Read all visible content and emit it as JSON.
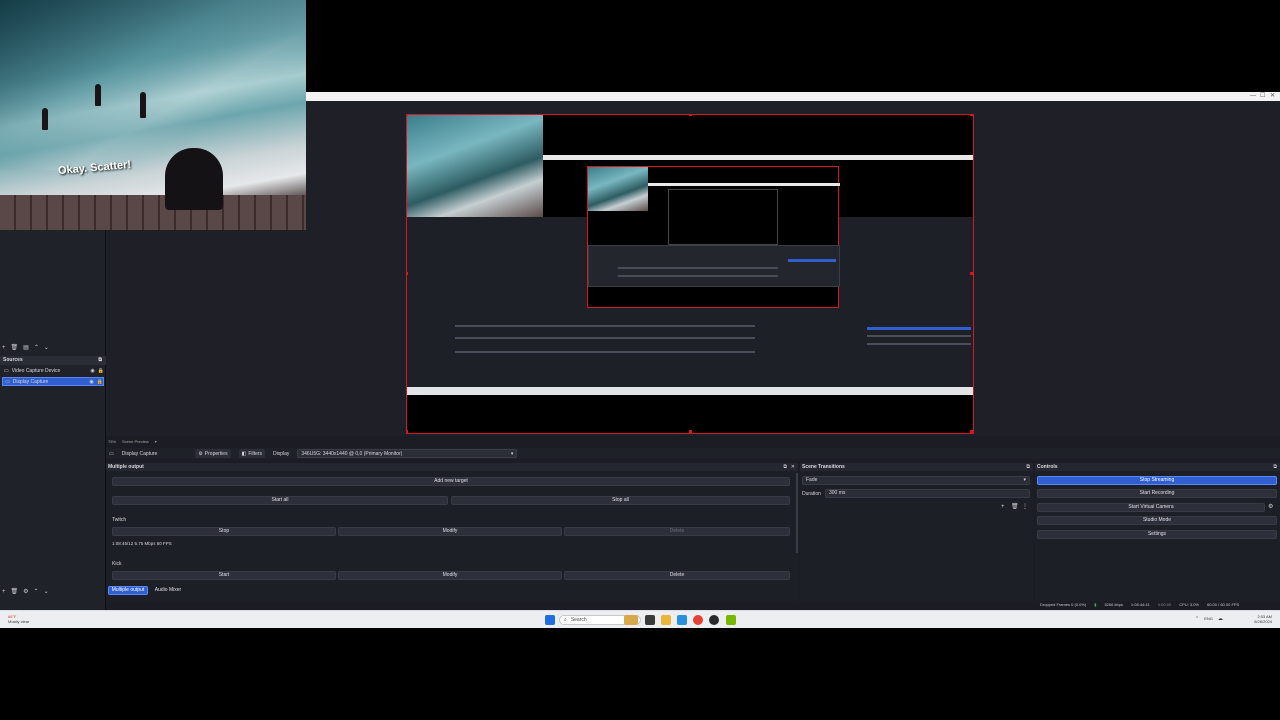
{
  "window": {
    "controls": [
      "—",
      "☐",
      "✕"
    ]
  },
  "video": {
    "subtitle": "Okay. Scatter!"
  },
  "zoom_bar": {
    "zoom": "75%",
    "scene": "Scene Preview"
  },
  "sources": {
    "title": "Sources",
    "items": [
      {
        "label": "Video Capture Device",
        "selected": false
      },
      {
        "label": "Display Capture",
        "selected": true
      }
    ]
  },
  "source_toolbar": {
    "current": "Display Capture",
    "properties": "Properties",
    "filters": "Filters",
    "display_label": "Display",
    "display_value": "346U5G: 3440x1440 @ 0,0 (Primary Monitor)"
  },
  "multiple_output": {
    "title": "Multiple output",
    "add_target": "Add new target",
    "start_all": "Start all",
    "stop_all": "Stop all",
    "targets": [
      {
        "name": "Twitch",
        "btn1": "Stop",
        "btn2": "Modify",
        "btn3": "Delete",
        "stats": "1:08:45/12  5.75 Mbps  60 FPS"
      },
      {
        "name": "Kick",
        "btn1": "Start",
        "btn2": "Modify",
        "btn3": "Delete",
        "stats": ""
      }
    ]
  },
  "bottom_tabs": {
    "tab1": "Multiple output",
    "tab2": "Audio Mixer"
  },
  "scene_transitions": {
    "title": "Scene Transitions",
    "transition": "Fade",
    "duration_label": "Duration",
    "duration_value": "300 ms"
  },
  "controls": {
    "title": "Controls",
    "buttons": [
      "Stop Streaming",
      "Start Recording",
      "Start Virtual Camera",
      "Studio Mode",
      "Settings"
    ]
  },
  "status": {
    "dropped": "Dropped Frames 0 (0.0%)",
    "bitrate": "5266 kbps",
    "stream_time": "1:08:44:41",
    "rec_time": "0:00:00",
    "cpu": "CPU: 3.0%",
    "fps": "60.00 / 60.00 FPS"
  },
  "taskbar": {
    "weather_temp": "66°F",
    "weather_desc": "Mostly clear",
    "search": "Search",
    "time": "2:53 AM",
    "date": "6/28/2024",
    "tray": [
      "⌃",
      "ENG",
      "☁"
    ]
  },
  "colors": {
    "accent": "#2f5fd0",
    "bounding_box": "#d41820",
    "panel": "#1d1f26"
  }
}
